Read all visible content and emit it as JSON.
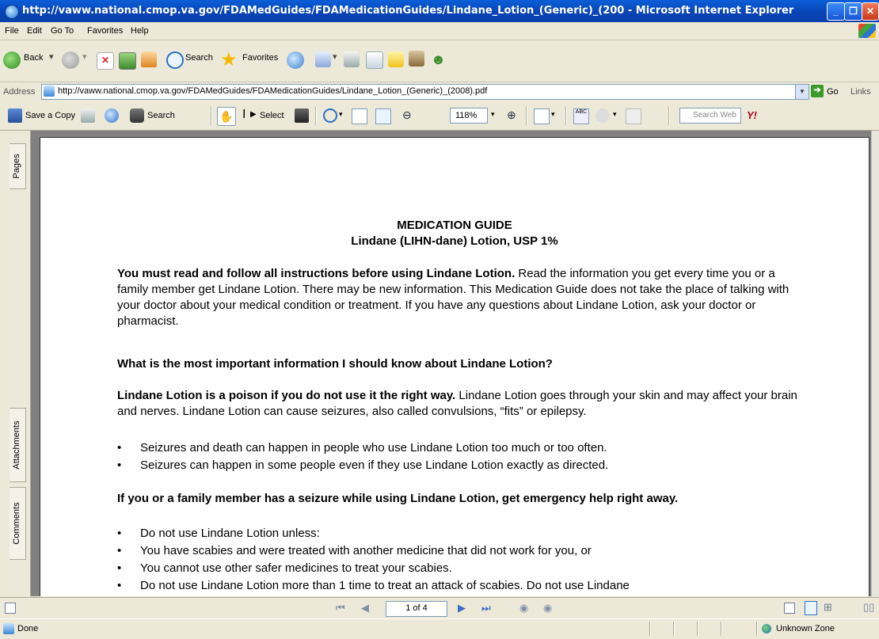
{
  "window": {
    "title": "http://vaww.national.cmop.va.gov/FDAMedGuides/FDAMedicationGuides/Lindane_Lotion_(Generic)_(200 - Microsoft Internet Explorer",
    "minimize": "_",
    "maximize": "❐",
    "close": "✕"
  },
  "menu": [
    "File",
    "Edit",
    "Go To",
    "Favorites",
    "Help"
  ],
  "toolbar": {
    "back": "Back",
    "search": "Search",
    "favorites": "Favorites"
  },
  "address": {
    "label": "Address",
    "url": "http://vaww.national.cmop.va.gov/FDAMedGuides/FDAMedicationGuides/Lindane_Lotion_(Generic)_(2008).pdf",
    "go": "Go",
    "links": "Links"
  },
  "reader": {
    "save_copy": "Save a Copy",
    "search": "Search",
    "select": "Select",
    "zoom": "118%",
    "search_web_placeholder": "Search Web",
    "yahoo": "Y!"
  },
  "side_tabs": {
    "pages": "Pages",
    "attachments": "Attachments",
    "comments": "Comments"
  },
  "document": {
    "heading1": "MEDICATION GUIDE",
    "heading2": "Lindane (LIHN-dane) Lotion, USP 1%",
    "p1_bold": "You must read and follow all instructions before using Lindane Lotion.",
    "p1_rest": " Read the information you get every time you or a family member get Lindane Lotion. There may be new information. This Medication Guide does not take the place of talking with your doctor about your medical condition or treatment. If you have any questions about Lindane Lotion, ask your doctor or pharmacist.",
    "q1": "What is the most important information I should know about Lindane Lotion?",
    "p2_bold": "Lindane Lotion is a poison if you do not use it the right way.",
    "p2_rest": " Lindane Lotion goes through your skin and may affect your brain and nerves. Lindane Lotion can cause seizures, also called convulsions, “fits” or epilepsy.",
    "bullets1": [
      "Seizures and death can happen in people who use Lindane Lotion too much or too often.",
      "Seizures can happen in some people even if they use Lindane Lotion exactly as directed."
    ],
    "p3": "If you or a family member has a seizure while using Lindane Lotion, get emergency help right away.",
    "bullets2": [
      "Do not use Lindane Lotion unless:",
      "You have scabies and were treated with another medicine that did not work for you, or",
      "You cannot use other safer medicines to treat your scabies.",
      "Do not use Lindane Lotion more than 1 time to treat an attack of scabies. Do not use Lindane"
    ],
    "bullet_char": "•"
  },
  "navbar": {
    "page_indicator": "1 of 4"
  },
  "status": {
    "text": "Done",
    "zone": "Unknown Zone"
  }
}
